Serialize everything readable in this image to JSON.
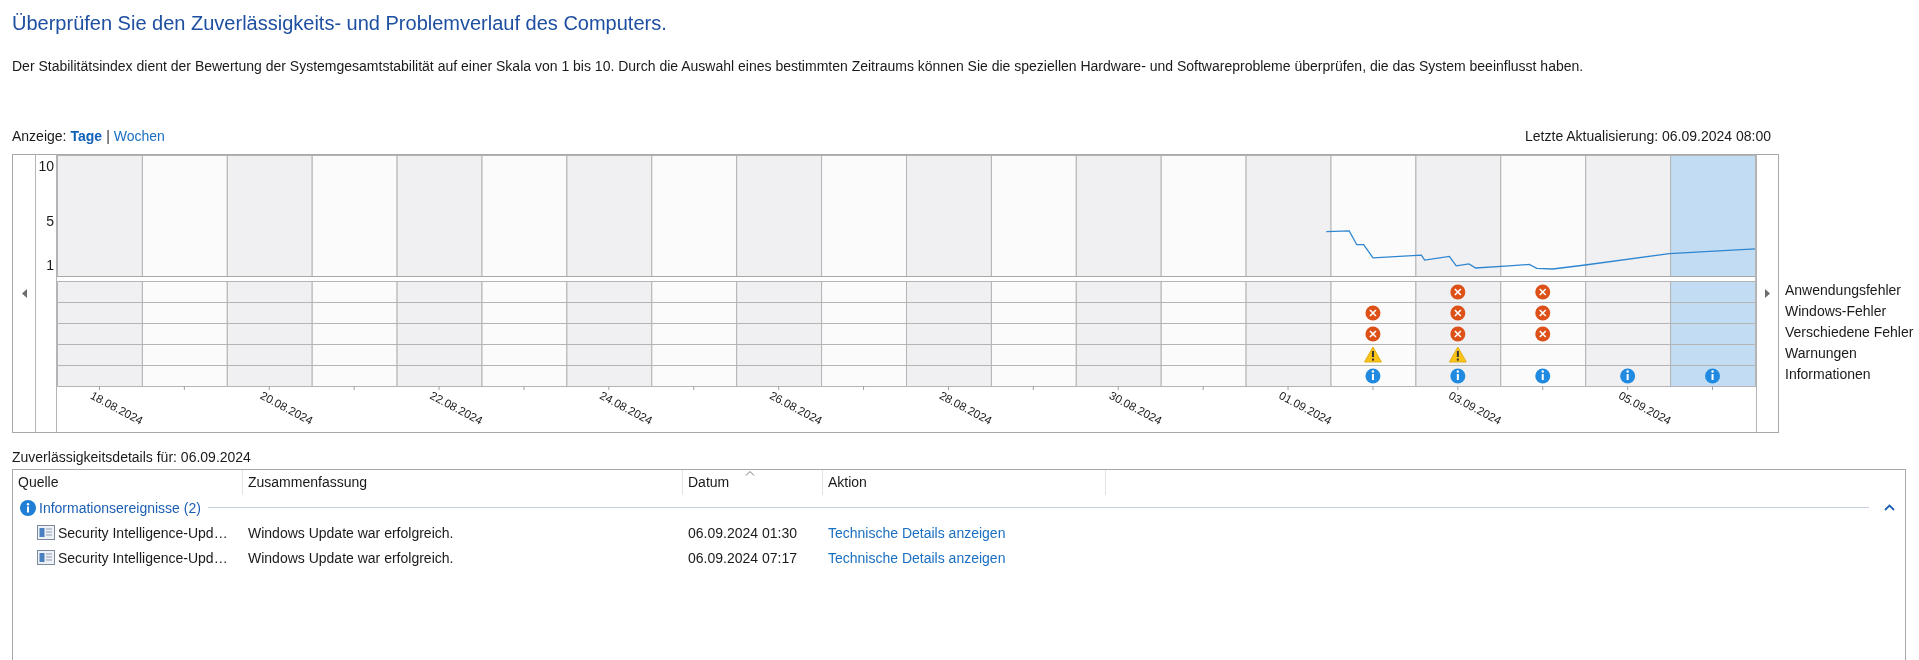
{
  "heading": "Überprüfen Sie den Zuverlässigkeits- und Problemverlauf des Computers.",
  "description": "Der Stabilitätsindex dient der Bewertung der Systemgesamtstabilität auf einer Skala von 1 bis 10. Durch die Auswahl eines bestimmten Zeitraums können Sie die speziellen Hardware- und Softwareprobleme überprüfen, die das System beeinflusst haben.",
  "view": {
    "label": "Anzeige:",
    "separator": "|",
    "options": [
      {
        "label": "Tage",
        "selected": true
      },
      {
        "label": "Wochen",
        "selected": false
      }
    ]
  },
  "last_update": "Letzte Aktualisierung: 06.09.2024 08:00",
  "timeline": {
    "y_labels": [
      "10",
      "5",
      "1"
    ],
    "date_labels": [
      "18.08.2024",
      "20.08.2024",
      "22.08.2024",
      "24.08.2024",
      "26.08.2024",
      "28.08.2024",
      "30.08.2024",
      "01.09.2024",
      "03.09.2024",
      "05.09.2024"
    ],
    "event_rows": [
      {
        "label": "Anwendungsfehler",
        "kind": "error"
      },
      {
        "label": "Windows-Fehler",
        "kind": "error"
      },
      {
        "label": "Verschiedene Fehler",
        "kind": "error"
      },
      {
        "label": "Warnungen",
        "kind": "warning"
      },
      {
        "label": "Informationen",
        "kind": "info"
      }
    ],
    "days": [
      {
        "selected": false,
        "marks": [
          false,
          false,
          false,
          false,
          false
        ]
      },
      {
        "selected": false,
        "marks": [
          false,
          false,
          false,
          false,
          false
        ]
      },
      {
        "selected": false,
        "marks": [
          false,
          false,
          false,
          false,
          false
        ]
      },
      {
        "selected": false,
        "marks": [
          false,
          false,
          false,
          false,
          false
        ]
      },
      {
        "selected": false,
        "marks": [
          false,
          false,
          false,
          false,
          false
        ]
      },
      {
        "selected": false,
        "marks": [
          false,
          false,
          false,
          false,
          false
        ]
      },
      {
        "selected": false,
        "marks": [
          false,
          false,
          false,
          false,
          false
        ]
      },
      {
        "selected": false,
        "marks": [
          false,
          false,
          false,
          false,
          false
        ]
      },
      {
        "selected": false,
        "marks": [
          false,
          false,
          false,
          false,
          false
        ]
      },
      {
        "selected": false,
        "marks": [
          false,
          false,
          false,
          false,
          false
        ]
      },
      {
        "selected": false,
        "marks": [
          false,
          false,
          false,
          false,
          false
        ]
      },
      {
        "selected": false,
        "marks": [
          false,
          false,
          false,
          false,
          false
        ]
      },
      {
        "selected": false,
        "marks": [
          false,
          false,
          false,
          false,
          false
        ]
      },
      {
        "selected": false,
        "marks": [
          false,
          false,
          false,
          false,
          false
        ]
      },
      {
        "selected": false,
        "marks": [
          false,
          false,
          false,
          false,
          false
        ]
      },
      {
        "selected": false,
        "marks": [
          false,
          true,
          true,
          true,
          true
        ]
      },
      {
        "selected": false,
        "marks": [
          true,
          true,
          true,
          true,
          true
        ]
      },
      {
        "selected": false,
        "marks": [
          true,
          true,
          true,
          false,
          true
        ]
      },
      {
        "selected": false,
        "marks": [
          false,
          false,
          false,
          false,
          true
        ]
      },
      {
        "selected": true,
        "marks": [
          false,
          false,
          false,
          false,
          true
        ]
      }
    ]
  },
  "details": {
    "caption": "Zuverlässigkeitsdetails für: 06.09.2024",
    "columns": [
      {
        "label": "Quelle",
        "sorted": false
      },
      {
        "label": "Zusammenfassung",
        "sorted": false
      },
      {
        "label": "Datum",
        "sorted": true
      },
      {
        "label": "Aktion",
        "sorted": false
      }
    ],
    "groups": [
      {
        "title": "Informationsereignisse (2)",
        "kind": "info",
        "expanded": true,
        "rows": [
          {
            "source": "Security Intelligence-Upd…",
            "summary": "Windows Update war erfolgreich.",
            "date": "06.09.2024 01:30",
            "action": "Technische Details anzeigen"
          },
          {
            "source": "Security Intelligence-Upd…",
            "summary": "Windows Update war erfolgreich.",
            "date": "06.09.2024 07:17",
            "action": "Technische Details anzeigen"
          }
        ]
      }
    ]
  }
}
